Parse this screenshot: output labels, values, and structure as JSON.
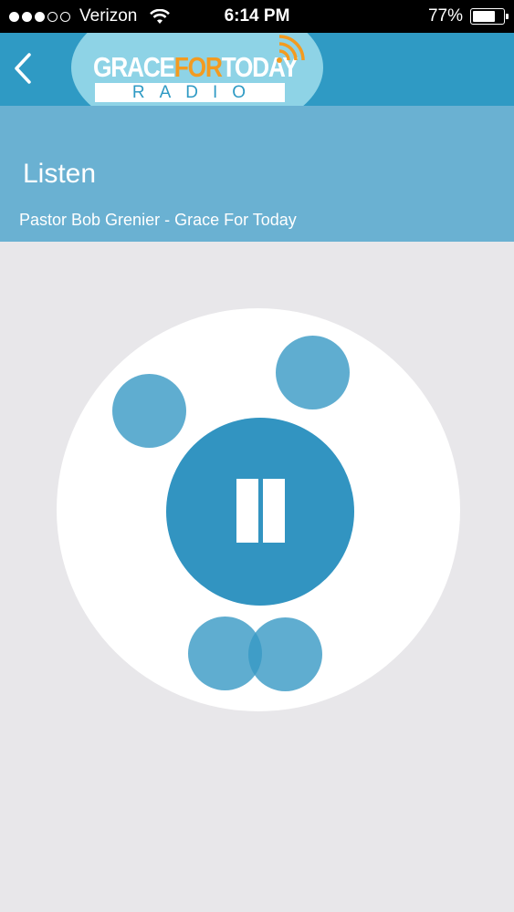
{
  "status_bar": {
    "carrier": "Verizon",
    "signal_bars": 3,
    "signal_total": 5,
    "time": "6:14 PM",
    "battery_text": "77%",
    "battery_level": 0.77
  },
  "nav": {
    "back_icon": "chevron-left-icon",
    "logo": {
      "grace": "GRACE",
      "for": "FOR",
      "today": "TODAY",
      "radio": "RADIO"
    }
  },
  "header": {
    "title": "Listen",
    "subtitle": "Pastor Bob Grenier - Grace For Today"
  },
  "player": {
    "state_icon": "pause-icon"
  },
  "colors": {
    "nav_bg": "#2f9ac4",
    "header_bg": "#6ab1d2",
    "accent": "#3294c1",
    "logo_orange": "#f39b20",
    "page_bg": "#e8e7ea"
  }
}
